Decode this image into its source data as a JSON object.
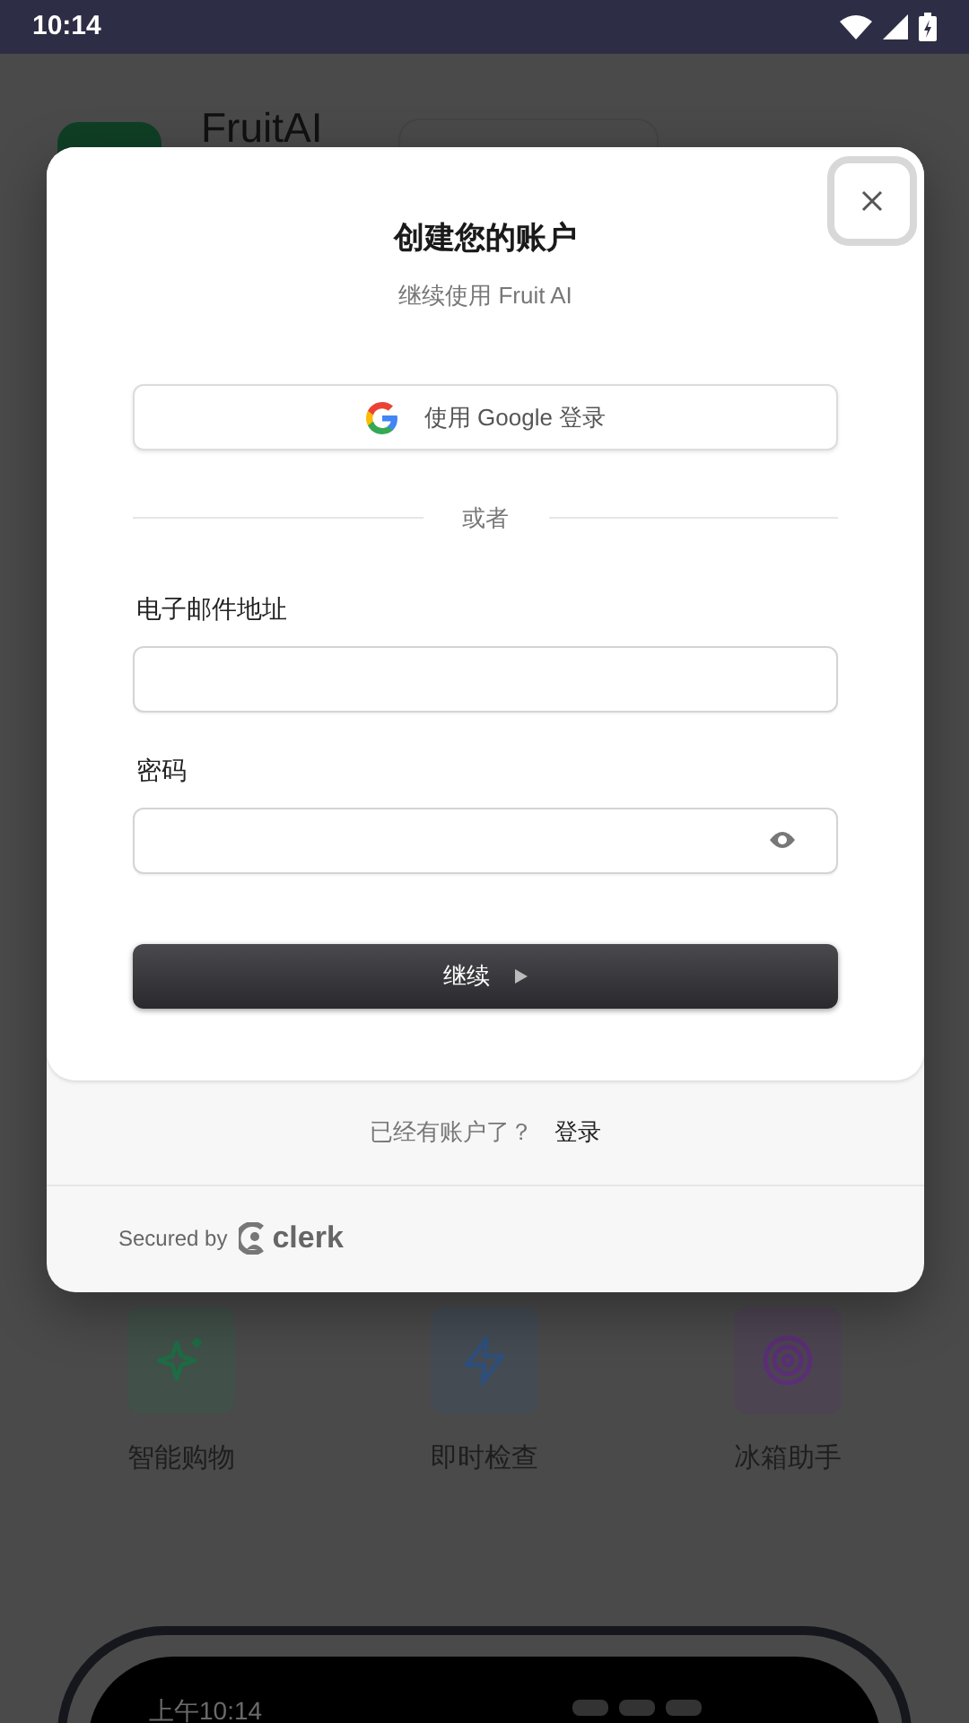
{
  "status_bar": {
    "time": "10:14"
  },
  "background_app": {
    "title": "FruitAI",
    "features": [
      {
        "label": "智能购物",
        "kind": "sparkle",
        "color": "#1f6b45"
      },
      {
        "label": "即时检查",
        "kind": "bolt",
        "color": "#2f4f7a"
      },
      {
        "label": "冰箱助手",
        "kind": "target",
        "color": "#5a2f75"
      }
    ],
    "preview_time": "上午10:14"
  },
  "dialog": {
    "title": "创建您的账户",
    "subtitle": "继续使用 Fruit AI",
    "google_button": "使用 Google 登录",
    "divider": "或者",
    "fields": [
      {
        "label": "电子邮件地址",
        "kind": "text"
      },
      {
        "label": "密码",
        "kind": "password"
      }
    ],
    "submit": "继续",
    "footer_prompt": "已经有账户了？",
    "footer_link": "登录",
    "secured_by": "Secured by",
    "brand": "clerk"
  }
}
